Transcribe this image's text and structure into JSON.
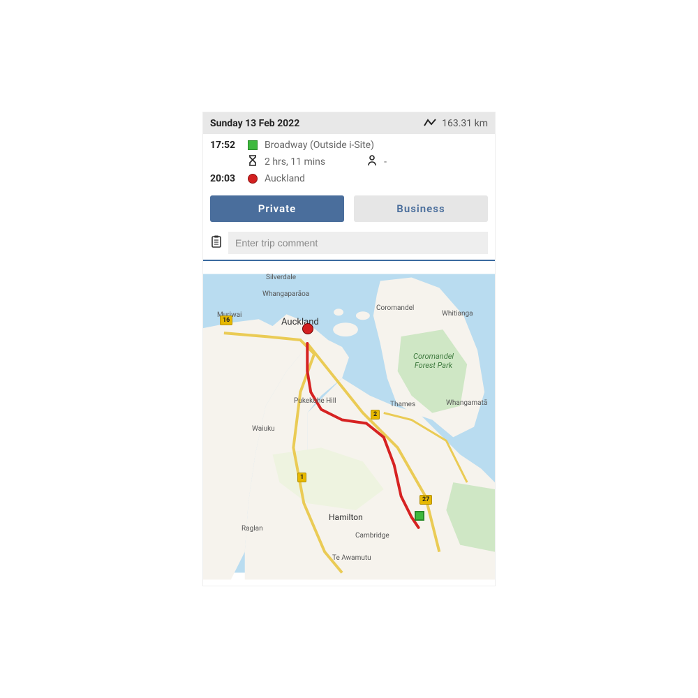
{
  "header": {
    "date": "Sunday 13 Feb 2022",
    "distance": "163.31 km"
  },
  "trip": {
    "start_time": "17:52",
    "start_location": "Broadway (Outside i-Site)",
    "duration": "2 hrs, 11 mins",
    "passengers": "-",
    "end_time": "20:03",
    "end_location": "Auckland"
  },
  "buttons": {
    "private": "Private",
    "business": "Business"
  },
  "comment": {
    "placeholder": "Enter trip comment"
  },
  "map": {
    "labels": {
      "silverdale": "Silverdale",
      "whangaparaoa": "Whangaparāoa",
      "muriwai": "Muriwai",
      "auckland": "Auckland",
      "coromandel": "Coromandel",
      "whitianga": "Whitianga",
      "cfpark": "Coromandel Forest Park",
      "pukekohe": "Pukekohe Hill",
      "thames": "Thames",
      "whangamata": "Whangamatā",
      "waiuku": "Waiuku",
      "hamilton": "Hamilton",
      "cambridge": "Cambridge",
      "raglan": "Raglan",
      "teawamutu": "Te Awamutu"
    },
    "shields": {
      "r16": "16",
      "r2": "2",
      "r1": "1",
      "r27": "27"
    }
  }
}
